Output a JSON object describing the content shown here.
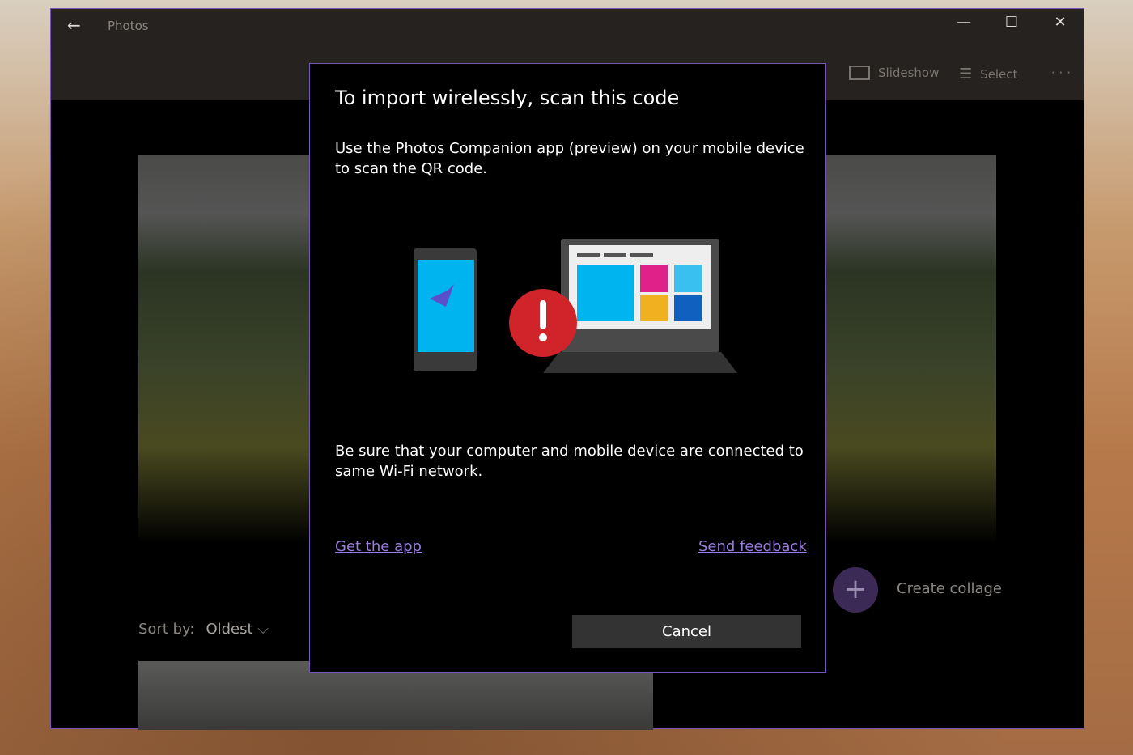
{
  "window": {
    "title": "Photos",
    "back_icon": "arrow-left-icon"
  },
  "toolbar": {
    "slideshow": "Slideshow",
    "select": "Select",
    "more": "· · ·"
  },
  "sort": {
    "label": "Sort by:",
    "value": "Oldest"
  },
  "collage": {
    "label": "Create collage"
  },
  "dialog": {
    "title": "To import wirelessly, scan this code",
    "instruction": "Use the Photos Companion app (preview) on your mobile device to scan the QR code.",
    "network_note": "Be sure that your computer and mobile device are connected to same Wi-Fi network.",
    "get_app": "Get the app",
    "feedback": "Send feedback",
    "cancel": "Cancel",
    "error_icon": "exclamation-icon"
  },
  "colors": {
    "accent": "#7a55b8",
    "link": "#9b7ee0",
    "error": "#d1232a",
    "screen": "#00b4f0"
  }
}
